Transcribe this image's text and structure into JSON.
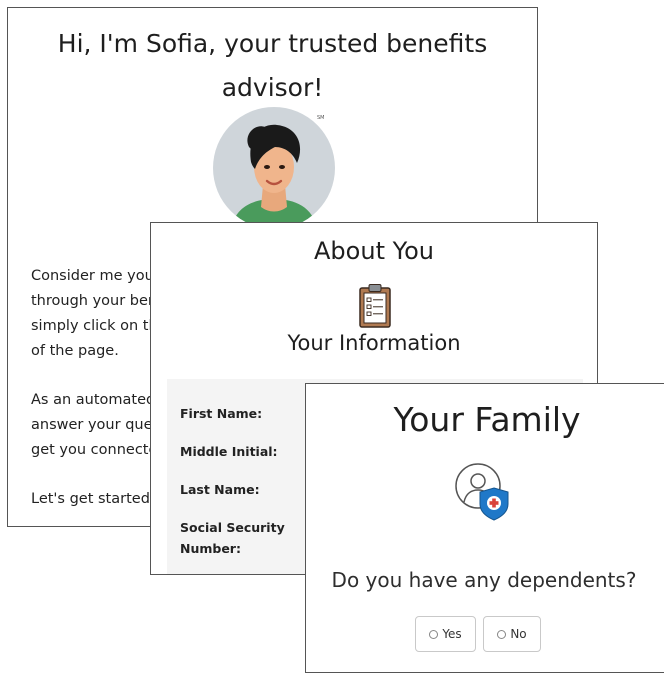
{
  "sofia_card": {
    "greeting": "Hi, I'm Sofia, your trusted benefits advisor!",
    "avatar_mark": "SM",
    "paragraphs": [
      [
        "Consider me you",
        "through your ber",
        "simply click on th",
        "of the page."
      ],
      [
        "As an automated",
        "answer your que",
        "get you connecte"
      ],
      [
        "Let's get started!"
      ]
    ]
  },
  "about_card": {
    "title": "About You",
    "subtitle": "Your Information",
    "fields": [
      {
        "label": "First Name:"
      },
      {
        "label": "Middle Initial:"
      },
      {
        "label": "Last Name:"
      },
      {
        "label_line1": "Social Security",
        "label_line2": "Number:"
      }
    ]
  },
  "family_card": {
    "title": "Your Family",
    "question": "Do you have any dependents?",
    "options": [
      {
        "label": "Yes",
        "selected": false
      },
      {
        "label": "No",
        "selected": false
      }
    ]
  },
  "colors": {
    "avatar_bg": "#cfd5da",
    "shield_blue": "#1f78c8",
    "clipboard_brown": "#b07a52"
  }
}
